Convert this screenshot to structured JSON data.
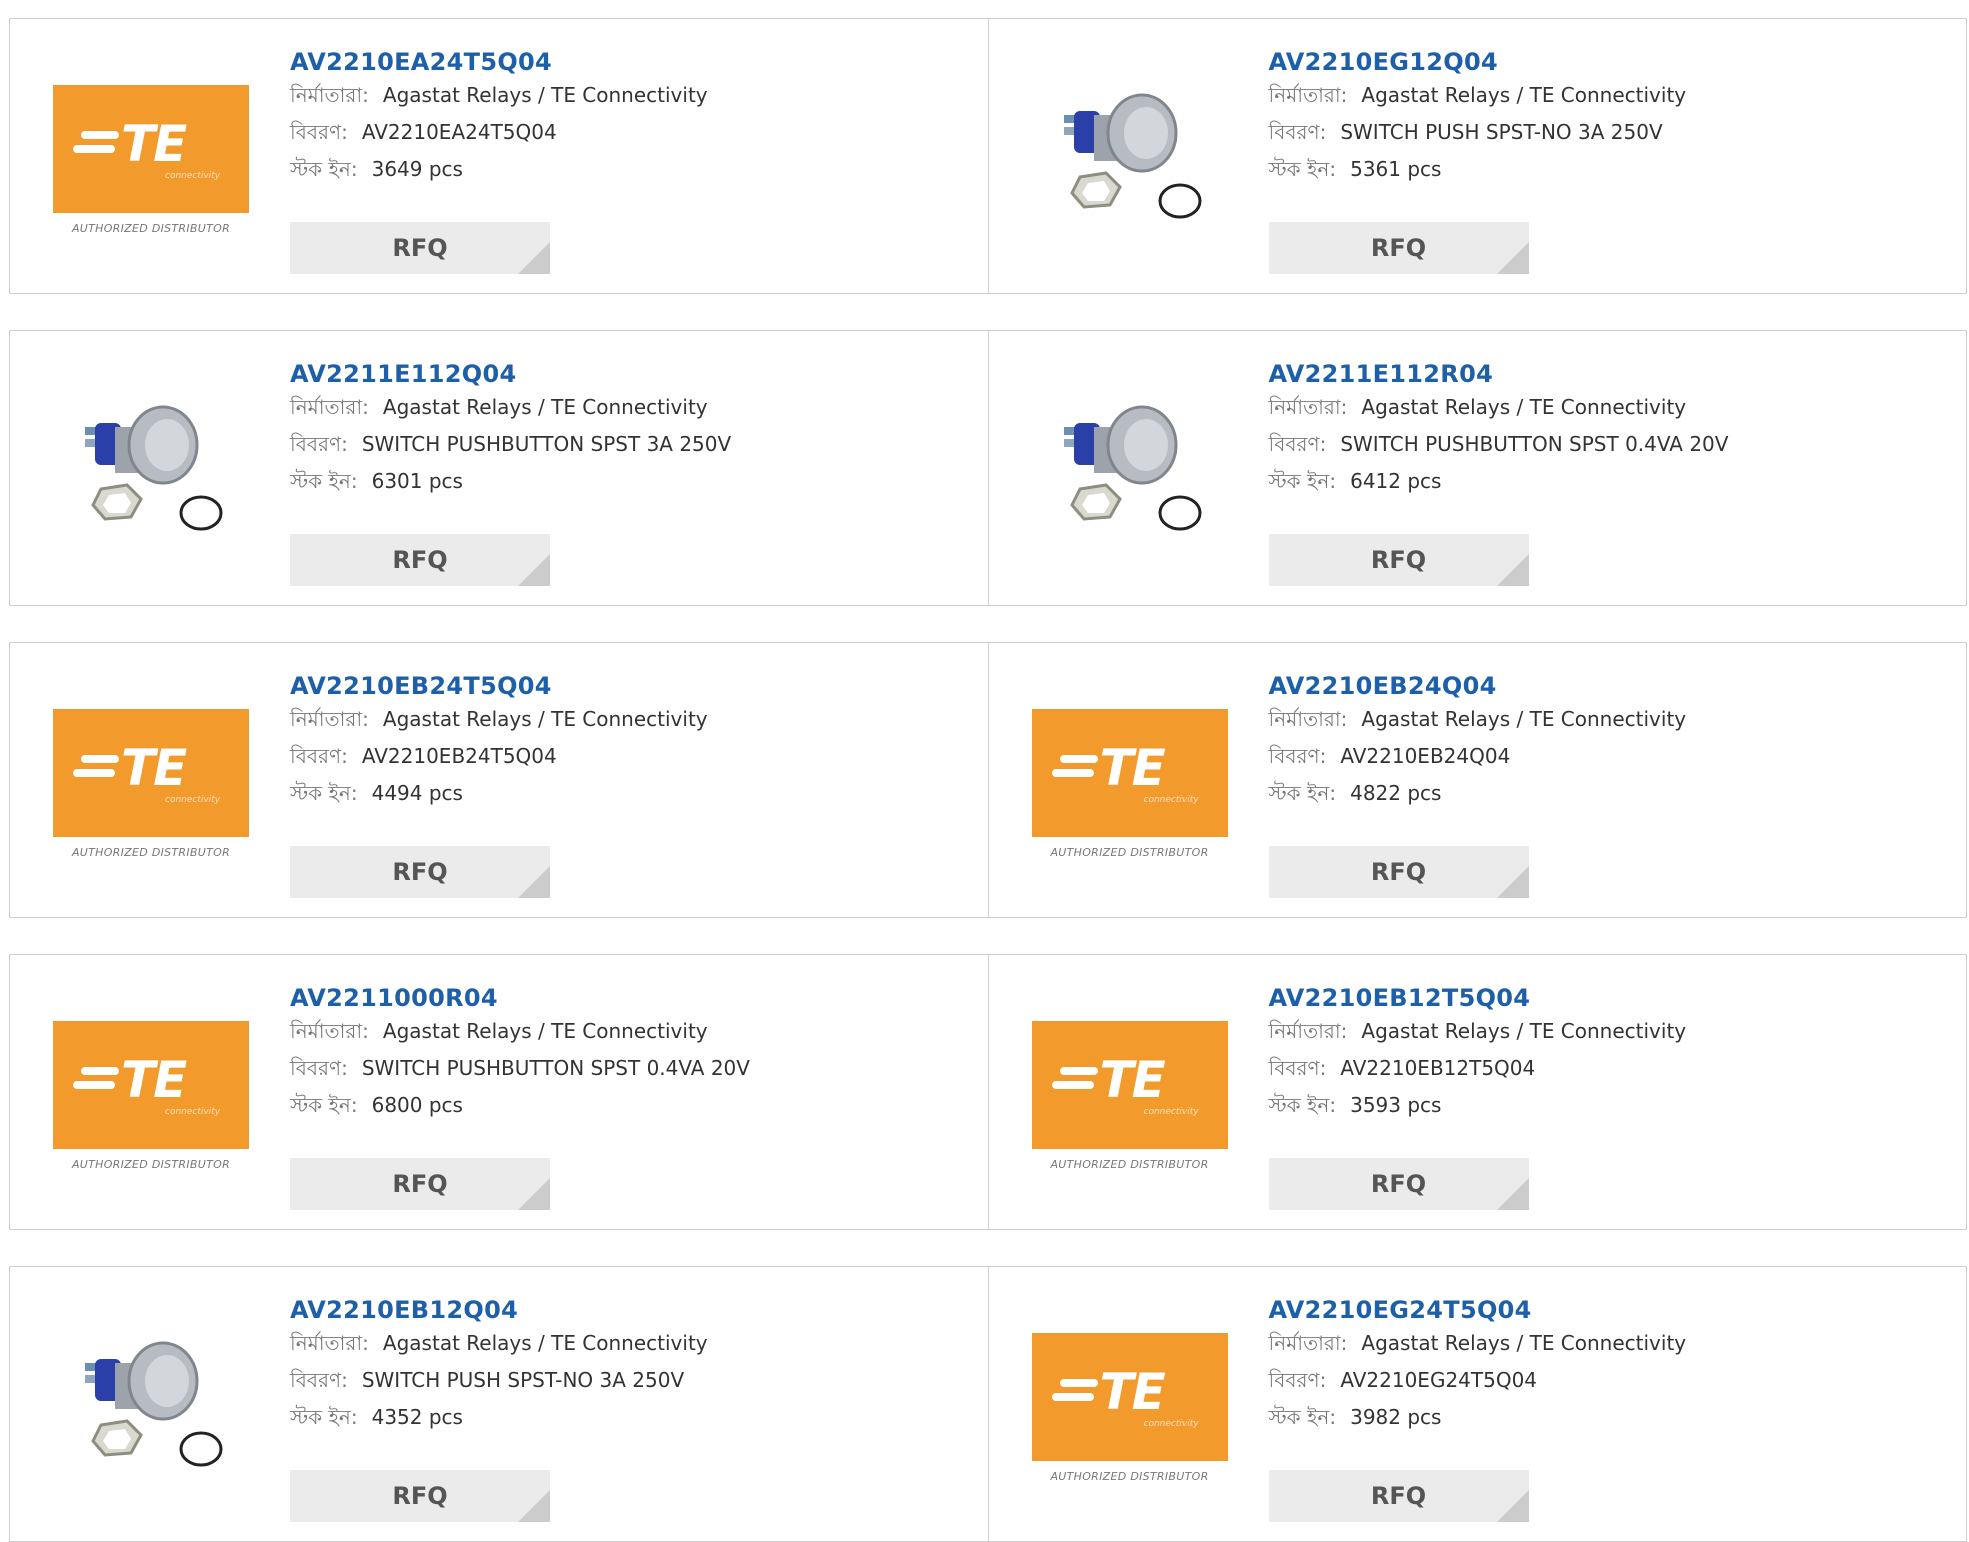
{
  "labels": {
    "manufacturer": "নির্মাতারা:",
    "description": "বিবরণ:",
    "stock": "স্টক ইন:",
    "rfq": "RFQ"
  },
  "logo": {
    "letters": "TE",
    "tagline": "connectivity",
    "authorized": "AUTHORIZED DISTRIBUTOR",
    "color": "#f39a2c"
  },
  "products": [
    {
      "part": "AV2210EA24T5Q04",
      "manufacturer": "Agastat Relays / TE Connectivity",
      "description": "AV2210EA24T5Q04",
      "stock": "3649 pcs",
      "image": "te-logo"
    },
    {
      "part": "AV2210EG12Q04",
      "manufacturer": "Agastat Relays / TE Connectivity",
      "description": "SWITCH PUSH SPST-NO 3A 250V",
      "stock": "5361 pcs",
      "image": "push-switch"
    },
    {
      "part": "AV2211E112Q04",
      "manufacturer": "Agastat Relays / TE Connectivity",
      "description": "SWITCH PUSHBUTTON SPST 3A 250V",
      "stock": "6301 pcs",
      "image": "push-switch"
    },
    {
      "part": "AV2211E112R04",
      "manufacturer": "Agastat Relays / TE Connectivity",
      "description": "SWITCH PUSHBUTTON SPST 0.4VA 20V",
      "stock": "6412 pcs",
      "image": "push-switch"
    },
    {
      "part": "AV2210EB24T5Q04",
      "manufacturer": "Agastat Relays / TE Connectivity",
      "description": "AV2210EB24T5Q04",
      "stock": "4494 pcs",
      "image": "te-logo"
    },
    {
      "part": "AV2210EB24Q04",
      "manufacturer": "Agastat Relays / TE Connectivity",
      "description": "AV2210EB24Q04",
      "stock": "4822 pcs",
      "image": "te-logo"
    },
    {
      "part": "AV2211000R04",
      "manufacturer": "Agastat Relays / TE Connectivity",
      "description": "SWITCH PUSHBUTTON SPST 0.4VA 20V",
      "stock": "6800 pcs",
      "image": "te-logo"
    },
    {
      "part": "AV2210EB12T5Q04",
      "manufacturer": "Agastat Relays / TE Connectivity",
      "description": "AV2210EB12T5Q04",
      "stock": "3593 pcs",
      "image": "te-logo"
    },
    {
      "part": "AV2210EB12Q04",
      "manufacturer": "Agastat Relays / TE Connectivity",
      "description": "SWITCH PUSH SPST-NO 3A 250V",
      "stock": "4352 pcs",
      "image": "push-switch"
    },
    {
      "part": "AV2210EG24T5Q04",
      "manufacturer": "Agastat Relays / TE Connectivity",
      "description": "AV2210EG24T5Q04",
      "stock": "3982 pcs",
      "image": "te-logo"
    }
  ]
}
